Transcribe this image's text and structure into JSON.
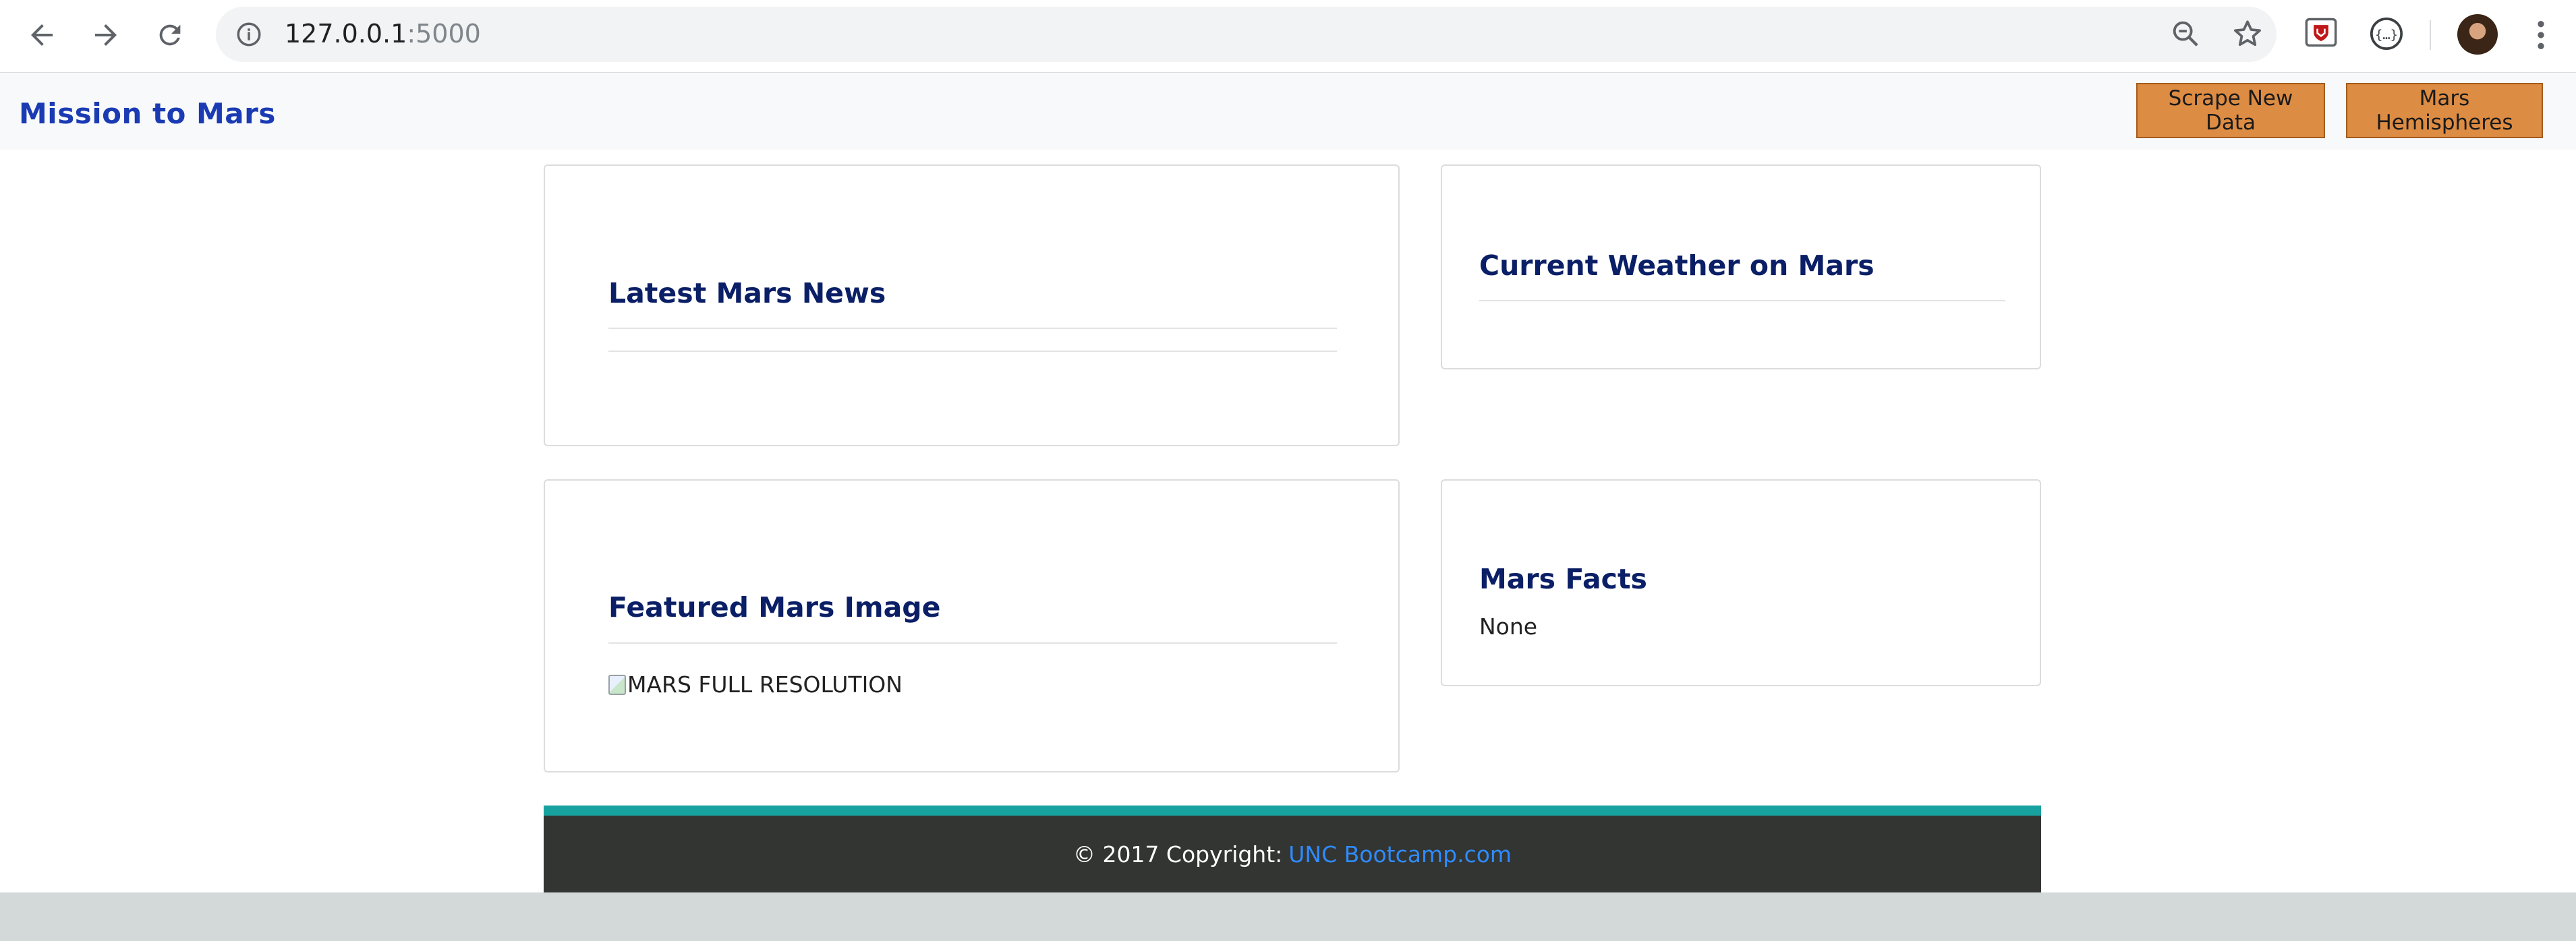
{
  "browser": {
    "url_host": "127.0.0.1",
    "url_port": ":5000",
    "icons": [
      "back-arrow-icon",
      "forward-arrow-icon",
      "reload-icon",
      "info-icon",
      "zoom-out-icon",
      "star-icon",
      "mcafee-shield-icon",
      "json-extension-icon",
      "profile-avatar",
      "more-vert-icon"
    ]
  },
  "navbar": {
    "brand": "Mission to Mars",
    "scrape_button": "Scrape New Data",
    "hemispheres_button": "Mars Hemispheres",
    "button_color": "#dd8c44",
    "brand_color": "#1a3bb3"
  },
  "cards": {
    "news": {
      "title": "Latest Mars News"
    },
    "weather": {
      "title": "Current Weather on Mars"
    },
    "image": {
      "title": "Featured Mars Image",
      "alt_text": "MARS FULL RESOLUTION"
    },
    "facts": {
      "title": "Mars Facts",
      "body": "None"
    }
  },
  "footer": {
    "copyright": "© 2017 Copyright:",
    "link_text": "UNC Bootcamp.com",
    "band_color": "#17a2a0",
    "background": "#333533"
  }
}
